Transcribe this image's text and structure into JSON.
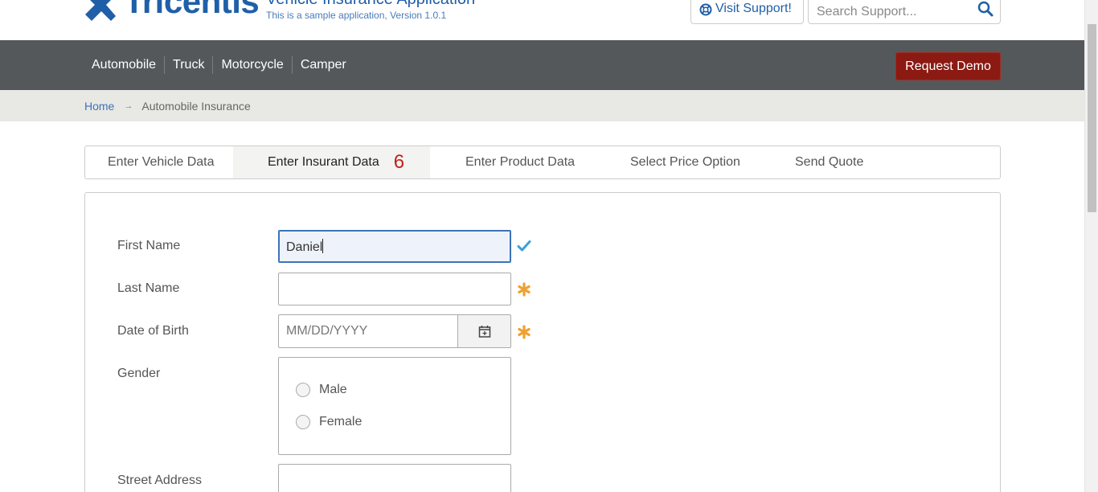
{
  "header": {
    "logo_text": "Tricentis",
    "app_title": "Vehicle Insurance Application",
    "app_subtitle": "This is a sample application, Version 1.0.1",
    "support_label": "Visit Support!",
    "search_placeholder": "Search Support..."
  },
  "nav": {
    "items": [
      "Automobile",
      "Truck",
      "Motorcycle",
      "Camper"
    ],
    "demo_button": "Request Demo"
  },
  "breadcrumb": {
    "home": "Home",
    "separator": "→",
    "current": "Automobile Insurance"
  },
  "tabs": [
    {
      "label": "Enter Vehicle Data"
    },
    {
      "label": "Enter Insurant Data",
      "count": "6"
    },
    {
      "label": "Enter Product Data"
    },
    {
      "label": "Select Price Option"
    },
    {
      "label": "Send Quote"
    }
  ],
  "form": {
    "first_name": {
      "label": "First Name",
      "value": "Daniel"
    },
    "last_name": {
      "label": "Last Name",
      "value": ""
    },
    "date_of_birth": {
      "label": "Date of Birth",
      "placeholder": "MM/DD/YYYY"
    },
    "gender": {
      "label": "Gender",
      "options": [
        "Male",
        "Female"
      ]
    },
    "street_address": {
      "label": "Street Address",
      "value": ""
    }
  },
  "colors": {
    "brand_blue": "#1f5fa8",
    "nav_bg": "#54585b",
    "demo_button": "#8b1a12",
    "required_marker": "#f0a030",
    "valid_check": "#3aa0d8",
    "tab_count": "#c0201a"
  }
}
